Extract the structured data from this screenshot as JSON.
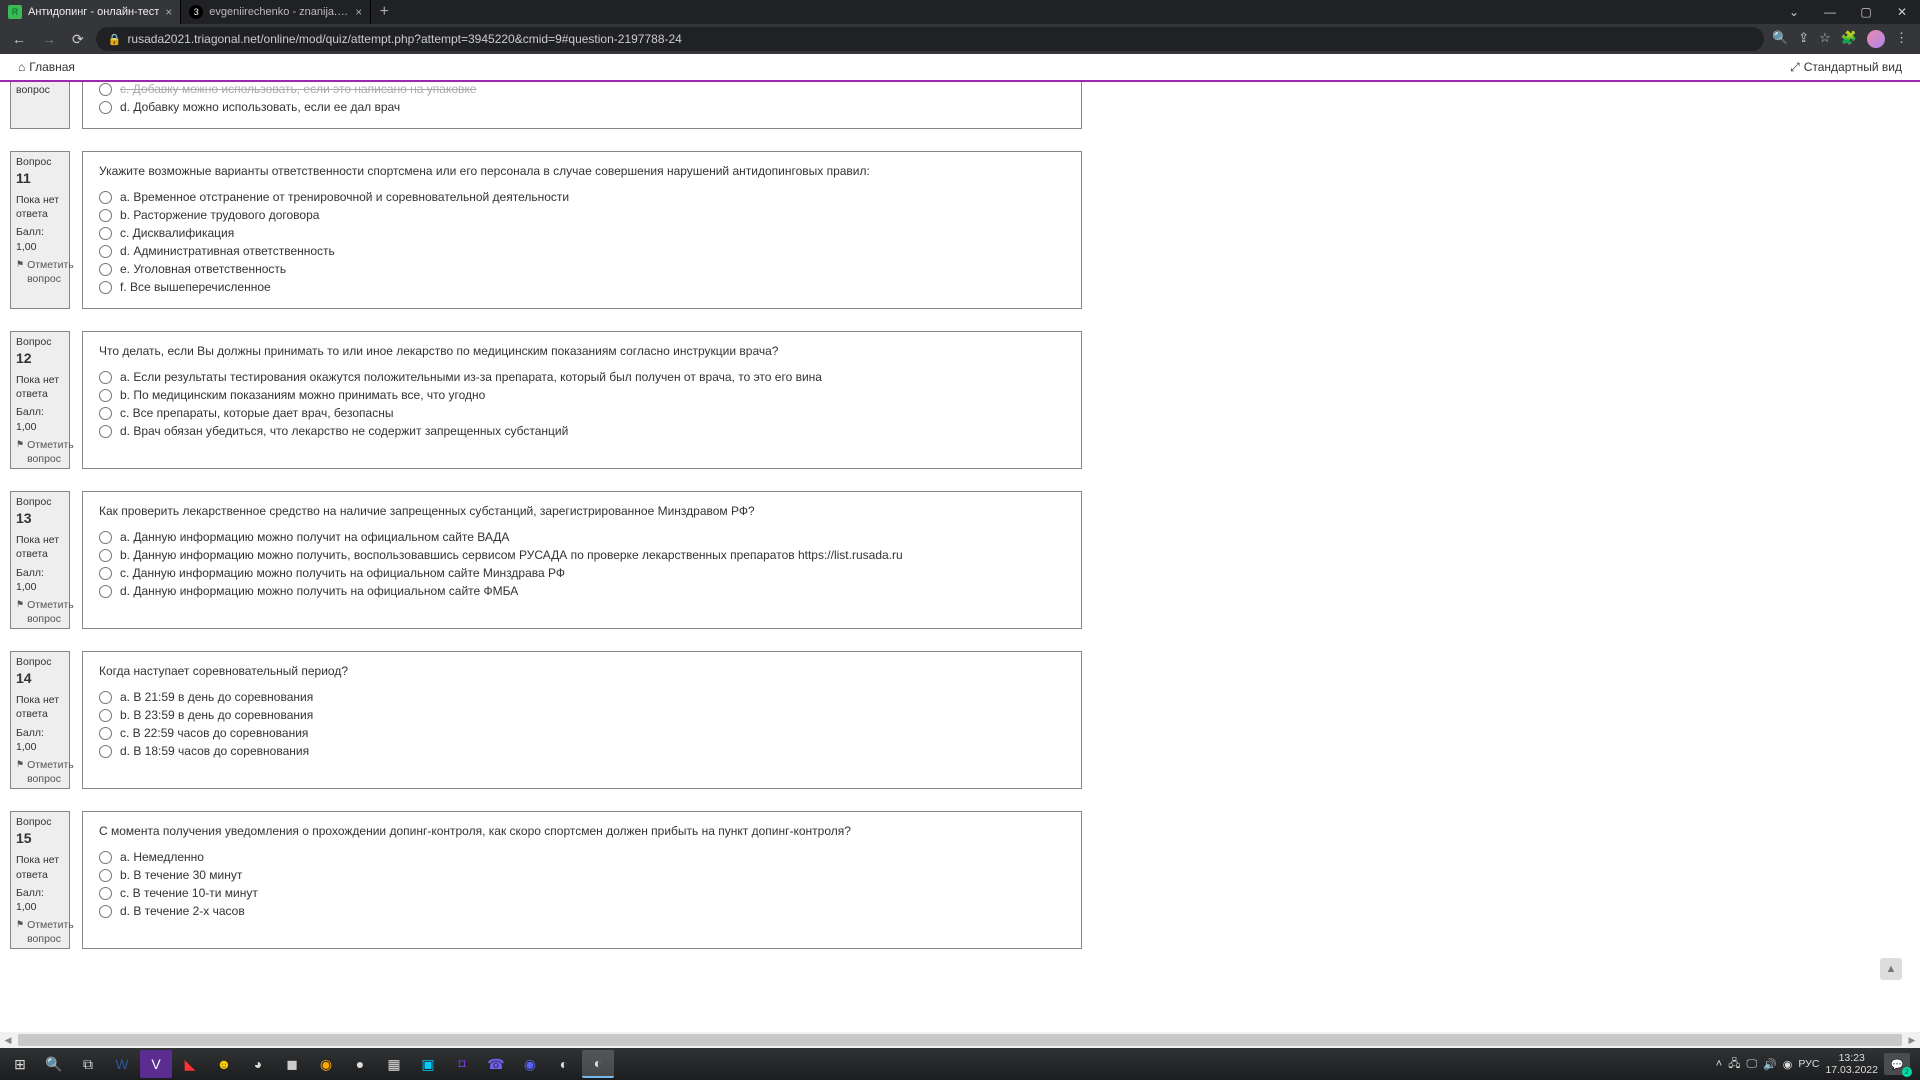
{
  "browser": {
    "tabs": [
      {
        "title": "Антидопинг - онлайн-тест"
      },
      {
        "title": "evgeniirechenko - znanija.com"
      }
    ],
    "url": "rusada2021.triagonal.net/online/mod/quiz/attempt.php?attempt=3945220&cmid=9#question-2197788-24"
  },
  "topbar": {
    "home": "Главная",
    "standard_view": "Стандартный вид"
  },
  "labels": {
    "question_word": "Вопрос",
    "status": "Пока нет ответа",
    "score": "Балл: 1,00",
    "flag": "Отметить вопрос"
  },
  "partial_q10": {
    "flag_only": "вопрос",
    "options": [
      "c. Добавку можно использовать, если это написано на упаковке",
      "d. Добавку можно использовать, если ее дал врач"
    ]
  },
  "questions": [
    {
      "num": 11,
      "text": "Укажите возможные варианты ответственности спортсмена или его персонала в случае совершения нарушений антидопинговых правил:",
      "options": [
        "a. Временное отстранение от тренировочной и соревновательной деятельности",
        "b. Расторжение трудового договора",
        "c. Дисквалификация",
        "d. Административная ответственность",
        "e. Уголовная ответственность",
        "f. Все вышеперечисленное"
      ]
    },
    {
      "num": 12,
      "text": "Что делать, если Вы должны принимать то или иное лекарство по медицинским показаниям согласно инструкции врача?",
      "options": [
        "a. Если результаты тестирования окажутся положительными из-за препарата, который был получен от врача, то это его вина",
        "b. По медицинским показаниям можно принимать все, что угодно",
        "c. Все препараты, которые дает врач, безопасны",
        "d. Врач обязан убедиться, что лекарство не содержит запрещенных субстанций"
      ]
    },
    {
      "num": 13,
      "text": "Как проверить лекарственное средство на наличие запрещенных субстанций, зарегистрированное Минздравом РФ?",
      "options": [
        "a. Данную информацию можно получит на официальном сайте ВАДА",
        "b. Данную информацию можно получить, воспользовавшись сервисом РУСАДА по проверке лекарственных препаратов https://list.rusada.ru",
        "c. Данную информацию можно получить на официальном сайте Минздрава РФ",
        "d. Данную информацию можно получить на официальном сайте ФМБА"
      ]
    },
    {
      "num": 14,
      "text": "Когда наступает соревновательный период?",
      "options": [
        "a. В 21:59 в день до соревнования",
        "b. В 23:59 в день до соревнования",
        "c. В 22:59 часов до соревнования",
        "d. В 18:59 часов до соревнования"
      ]
    },
    {
      "num": 15,
      "text": "С момента получения уведомления о прохождении допинг-контроля, как скоро спортсмен должен прибыть на пункт допинг-контроля?",
      "options": [
        "a. Немедленно",
        "b. В течение 30 минут",
        "c. В течение 10-ти минут",
        "d. В течение 2-х часов"
      ]
    }
  ],
  "tray": {
    "lang": "РУС",
    "time": "13:23",
    "date": "17.03.2022",
    "notif_count": "2"
  }
}
